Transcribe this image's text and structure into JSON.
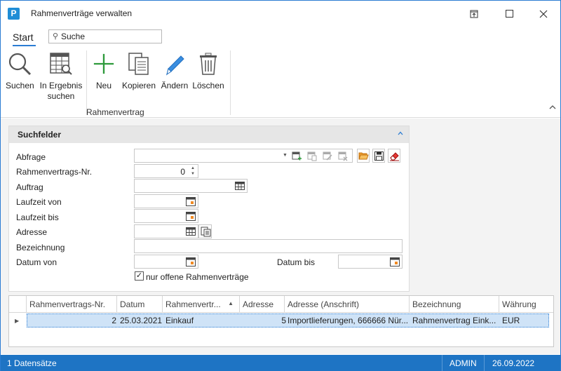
{
  "window": {
    "title": "Rahmenverträge verwalten",
    "app_icon": "P"
  },
  "ribbon": {
    "tab_start": "Start",
    "search_placeholder": "Suche",
    "buttons": {
      "suchen": "Suchen",
      "in_ergebnis_1": "In Ergebnis",
      "in_ergebnis_2": "suchen",
      "neu": "Neu",
      "kopieren": "Kopieren",
      "aendern": "Ändern",
      "loeschen": "Löschen"
    },
    "group_label": "Rahmenvertrag"
  },
  "panel": {
    "title": "Suchfelder",
    "fields": {
      "abfrage": "Abfrage",
      "nr": "Rahmenvertrags-Nr.",
      "nr_value": "0",
      "auftrag": "Auftrag",
      "laufzeit_von": "Laufzeit von",
      "laufzeit_bis": "Laufzeit bis",
      "adresse": "Adresse",
      "bezeichnung": "Bezeichnung",
      "datum_von": "Datum von",
      "datum_bis": "Datum bis",
      "nur_offene": "nur offene Rahmenverträge"
    }
  },
  "grid": {
    "columns": [
      "Rahmenvertrags-Nr.",
      "Datum",
      "Rahmenvertr...",
      "Adresse",
      "Adresse (Anschrift)",
      "Bezeichnung",
      "Währung"
    ],
    "rows": [
      [
        "2",
        "25.03.2021",
        "Einkauf",
        "5",
        "Importlieferungen, 666666 Nür...",
        "Rahmenvertrag Eink...",
        "EUR"
      ]
    ]
  },
  "status": {
    "records": "1 Datensätze",
    "user": "ADMIN",
    "date": "26.09.2022"
  },
  "colors": {
    "accent": "#2b7cd3",
    "statusbar": "#1e74c4",
    "selected_row": "#cfe3f7"
  }
}
